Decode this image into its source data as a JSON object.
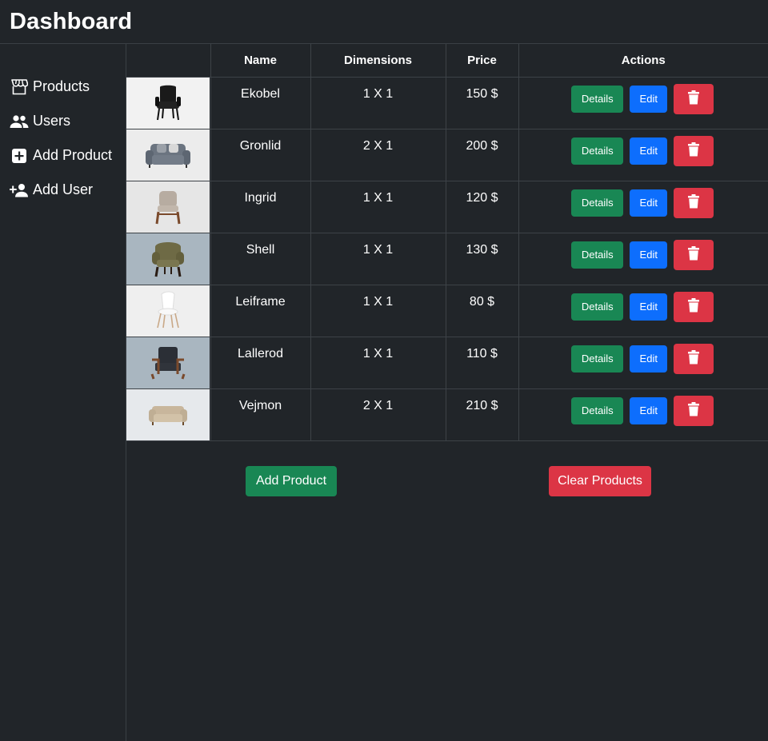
{
  "header": {
    "title": "Dashboard"
  },
  "sidebar": {
    "items": [
      {
        "label": "Products",
        "icon": "store-icon"
      },
      {
        "label": "Users",
        "icon": "users-icon"
      },
      {
        "label": "Add Product",
        "icon": "plus-square-icon"
      },
      {
        "label": "Add User",
        "icon": "user-plus-icon"
      }
    ]
  },
  "table": {
    "columns": [
      "",
      "Name",
      "Dimensions",
      "Price",
      "Actions"
    ],
    "rows": [
      {
        "name": "Ekobel",
        "dimensions": "1 X 1",
        "price": "150 $"
      },
      {
        "name": "Gronlid",
        "dimensions": "2 X 1",
        "price": "200 $"
      },
      {
        "name": "Ingrid",
        "dimensions": "1 X 1",
        "price": "120 $"
      },
      {
        "name": "Shell",
        "dimensions": "1 X 1",
        "price": "130 $"
      },
      {
        "name": "Leiframe",
        "dimensions": "1 X 1",
        "price": "80 $"
      },
      {
        "name": "Lallerod",
        "dimensions": "1 X 1",
        "price": "110 $"
      },
      {
        "name": "Vejmon",
        "dimensions": "2 X 1",
        "price": "210 $"
      }
    ],
    "details_label": "Details",
    "edit_label": "Edit"
  },
  "actions": {
    "add_product": "Add Product",
    "clear_products": "Clear Products"
  },
  "colors": {
    "background": "#212529",
    "success": "#198754",
    "primary": "#0d6efd",
    "danger": "#dc3545"
  }
}
